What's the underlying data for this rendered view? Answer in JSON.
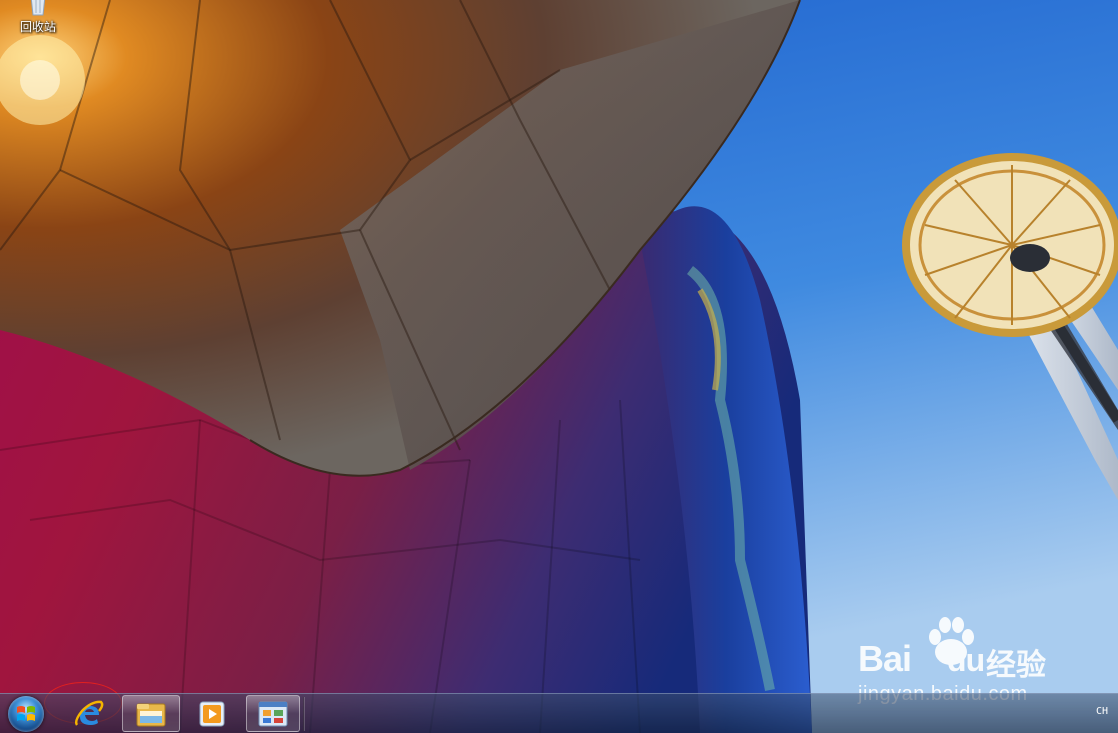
{
  "desktop": {
    "icons": [
      {
        "label": "回收站",
        "icon": "recycle-bin-icon"
      }
    ]
  },
  "watermark": {
    "brand": "Bai",
    "brand_suffix": "du",
    "brand_cn": "经验",
    "url": "jingyan.baidu.com"
  },
  "taskbar": {
    "start_icon": "windows-logo-icon",
    "pinned": [
      {
        "name": "Internet Explorer",
        "icon": "internet-explorer-icon"
      },
      {
        "name": "Windows Explorer",
        "icon": "folder-explorer-icon"
      },
      {
        "name": "Windows Media Player",
        "icon": "media-player-icon"
      },
      {
        "name": "Control Panel",
        "icon": "control-panel-icon"
      }
    ],
    "language": "CH"
  },
  "colors": {
    "sky": "#2a6fd0",
    "annotation_circle": "#e02020",
    "taskbar": "#2a3c5a"
  }
}
